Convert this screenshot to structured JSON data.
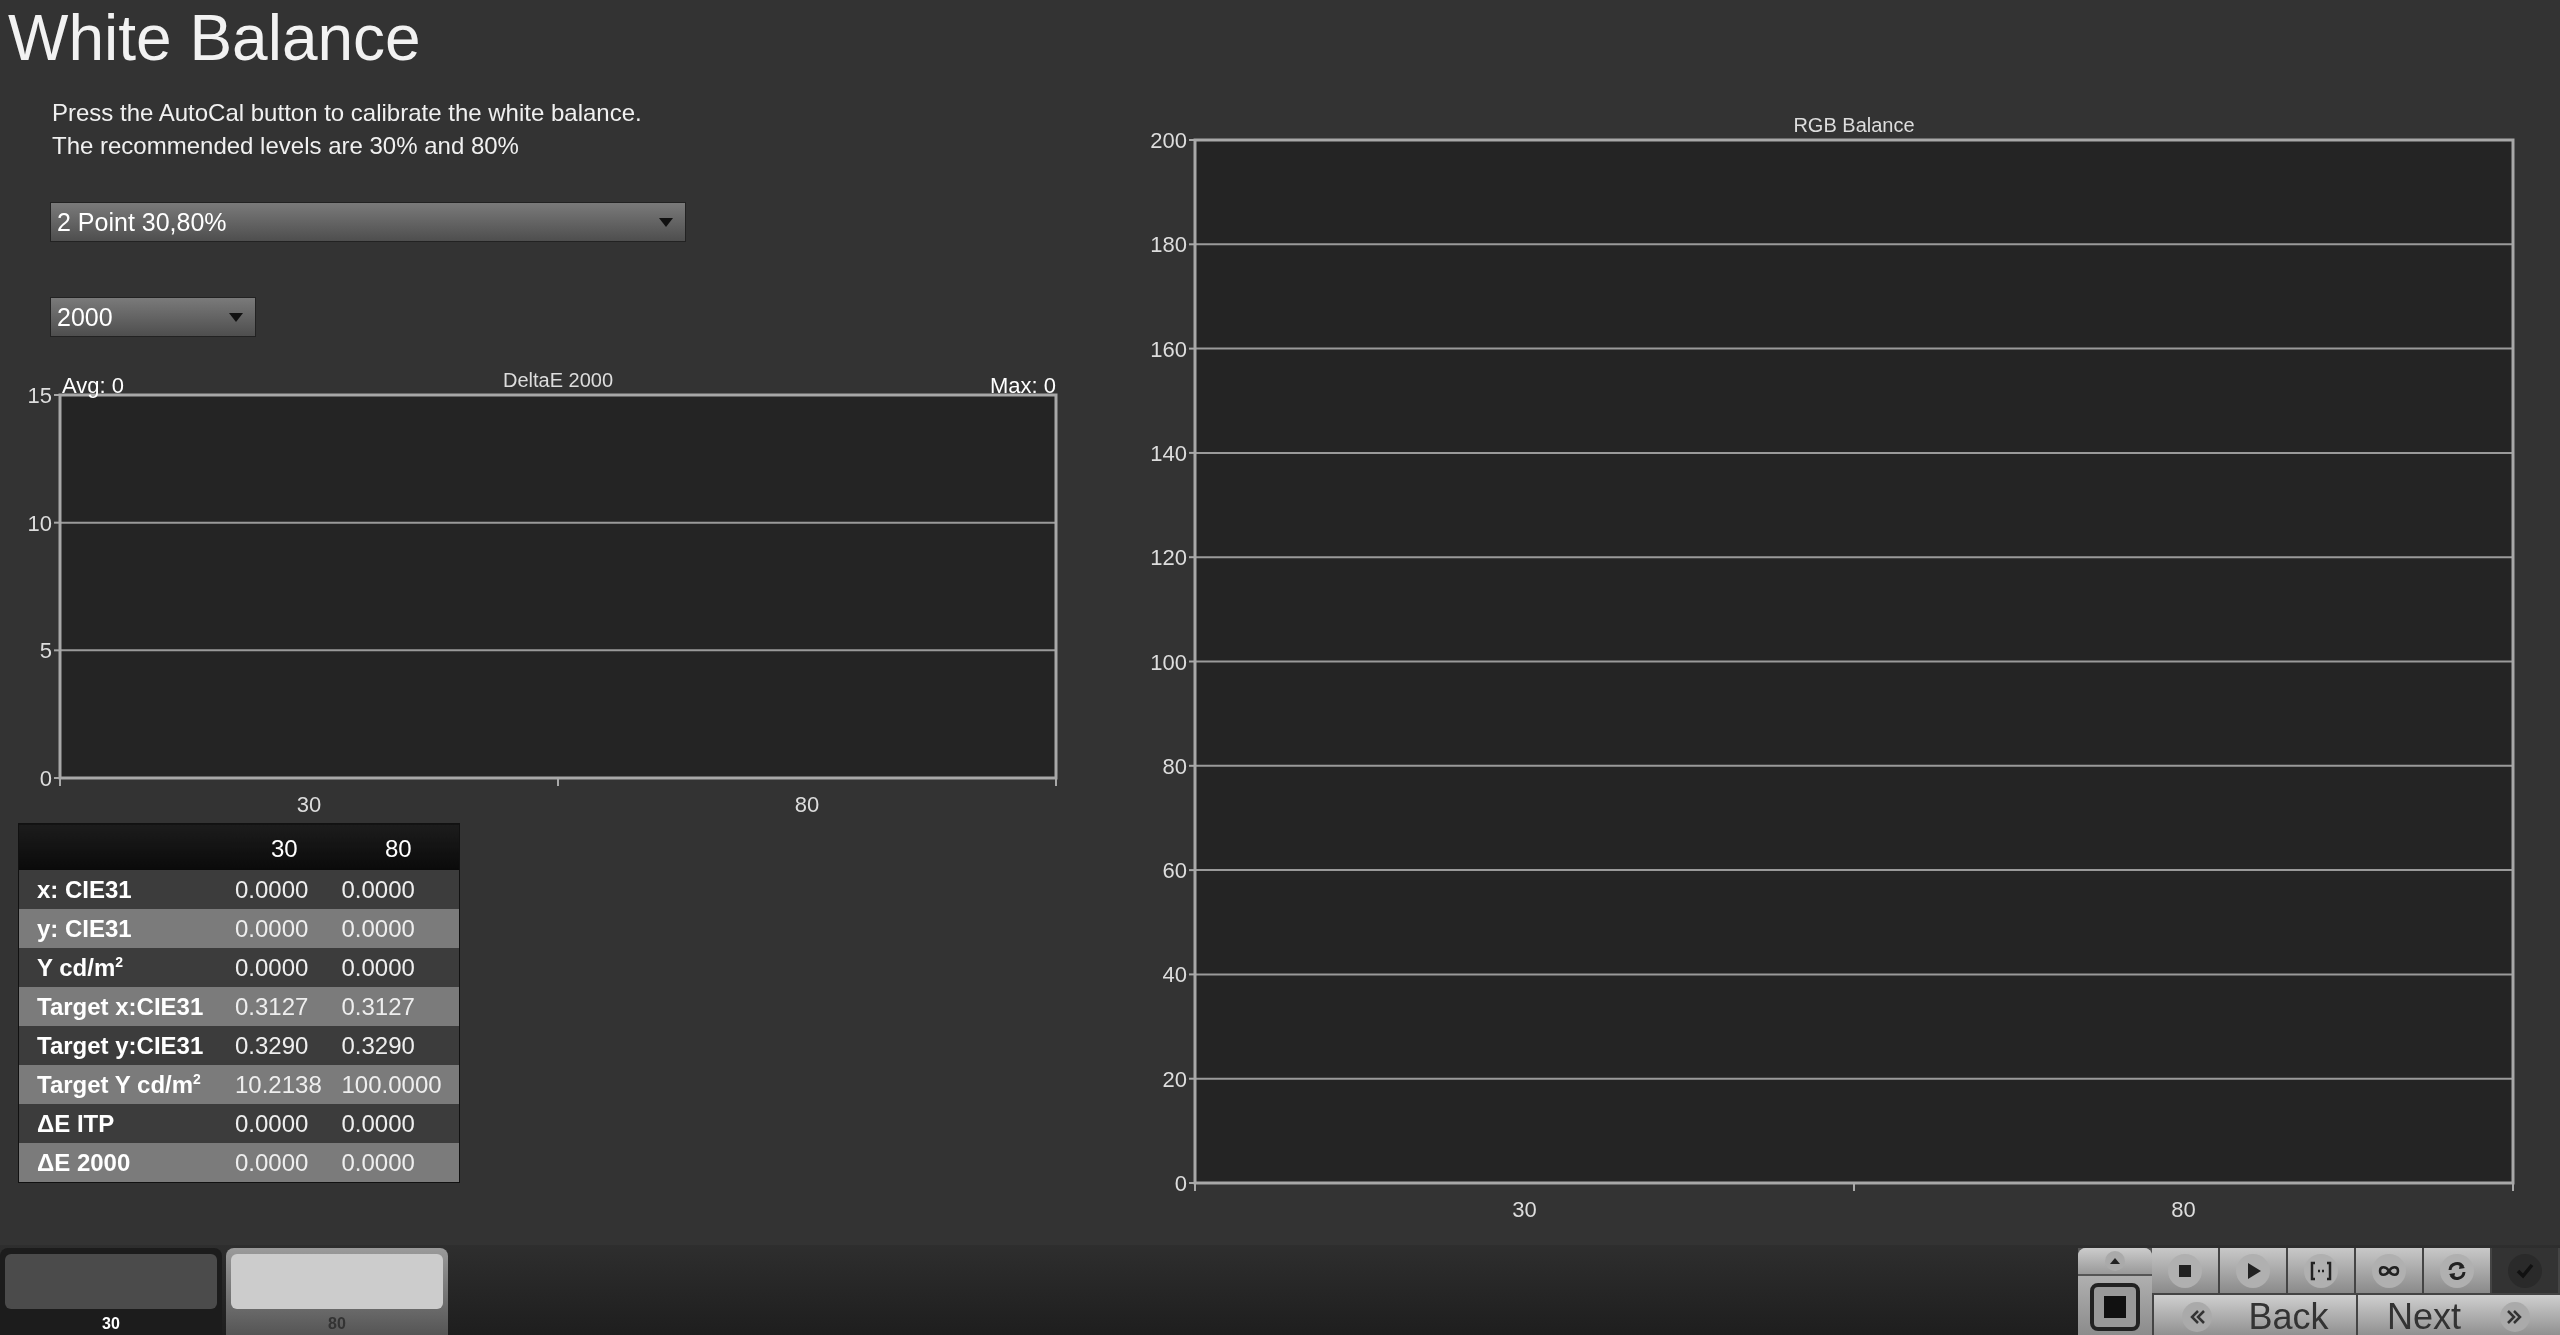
{
  "title": "White Balance",
  "instructions": [
    "Press the AutoCal button to calibrate the white balance.",
    "The recommended levels are 30% and 80%"
  ],
  "mode_dropdown": {
    "value": "2 Point 30,80%"
  },
  "delta_dropdown": {
    "value": "2000"
  },
  "delta_chart": {
    "avg": "Avg: 0",
    "max": "Max: 0",
    "chart_data": {
      "type": "bar",
      "title": "DeltaE 2000",
      "categories": [
        "30",
        "80"
      ],
      "values": [
        0,
        0
      ],
      "ylim": [
        0,
        15
      ],
      "yticks": [
        0,
        5,
        10,
        15
      ],
      "grid": true
    }
  },
  "table": {
    "columns": [
      "30",
      "80"
    ],
    "rows": [
      {
        "label": "x: CIE31",
        "values": [
          "0.0000",
          "0.0000"
        ]
      },
      {
        "label": "y: CIE31",
        "values": [
          "0.0000",
          "0.0000"
        ]
      },
      {
        "label": "Y cd/m$^{2}$",
        "values": [
          "0.0000",
          "0.0000"
        ]
      },
      {
        "label": "Target x:CIE31",
        "values": [
          "0.3127",
          "0.3127"
        ]
      },
      {
        "label": "Target y:CIE31",
        "values": [
          "0.3290",
          "0.3290"
        ]
      },
      {
        "label": "Target Y cd/m$^{2}$",
        "values": [
          "10.2138",
          "100.0000"
        ]
      },
      {
        "label": "ΔE ITP",
        "values": [
          "0.0000",
          "0.0000"
        ]
      },
      {
        "label": "ΔE 2000",
        "values": [
          "0.0000",
          "0.0000"
        ]
      }
    ]
  },
  "rgb_chart": {
    "chart_data": {
      "type": "bar",
      "title": "RGB Balance",
      "categories": [
        "30",
        "80"
      ],
      "values": [
        0,
        0
      ],
      "ylim": [
        0,
        200
      ],
      "yticks": [
        0,
        20,
        40,
        60,
        80,
        100,
        120,
        140,
        160,
        180,
        200
      ],
      "grid": true
    }
  },
  "swatches": [
    {
      "label": "30",
      "color": "#4b4b4b",
      "selected": true
    },
    {
      "label": "80",
      "color": "#cccccc",
      "selected": false
    }
  ],
  "toolbar": {
    "buttons": [
      {
        "kind": "stop",
        "disabled": false
      },
      {
        "kind": "play",
        "disabled": false
      },
      {
        "kind": "range",
        "disabled": false
      },
      {
        "kind": "loop",
        "disabled": false
      },
      {
        "kind": "refresh",
        "disabled": false
      },
      {
        "kind": "check",
        "disabled": true
      }
    ],
    "back": "Back",
    "next": "Next"
  }
}
